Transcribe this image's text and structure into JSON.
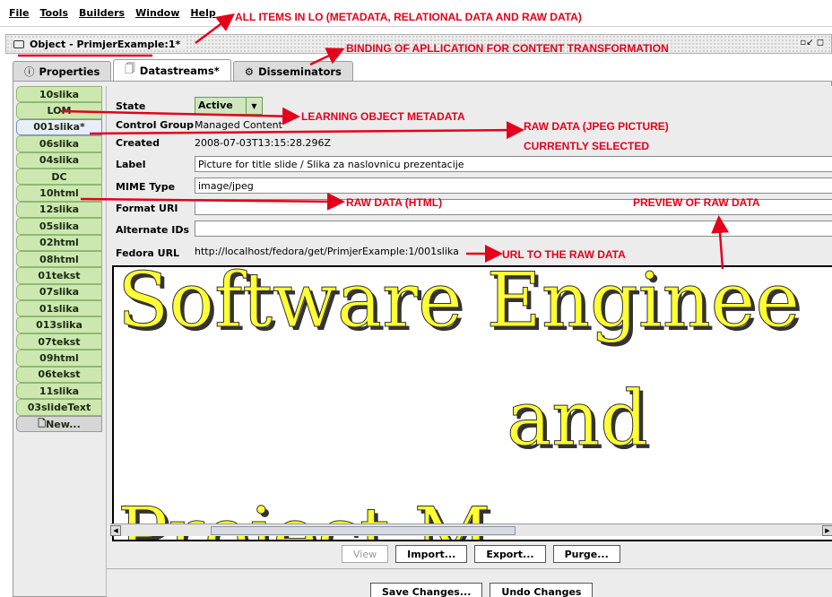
{
  "menubar": {
    "items": [
      "File",
      "Tools",
      "Builders",
      "Window",
      "Help"
    ]
  },
  "window": {
    "title": "Object - PrimjerExample:1*",
    "controls": "▫↙ ◻"
  },
  "tabs": [
    {
      "label": "Properties",
      "icon": "info-icon"
    },
    {
      "label": "Datastreams*",
      "icon": "document-icon"
    },
    {
      "label": "Disseminators",
      "icon": "gear-icon"
    }
  ],
  "datastreams": [
    "10slika",
    "LOM",
    "001slika*",
    "06slika",
    "04slika",
    "DC",
    "10html",
    "12slika",
    "05slika",
    "02html",
    "08html",
    "01tekst",
    "07slika",
    "01slika",
    "013slika",
    "07tekst",
    "09html",
    "06tekst",
    "11slika",
    "03slideText"
  ],
  "datastream_new": "New...",
  "selected_datastream": "001slika*",
  "fields": {
    "state_label": "State",
    "state_value": "Active",
    "control_group_label": "Control Group",
    "control_group_value": "Managed Content",
    "created_label": "Created",
    "created_value": "2008-07-03T13:15:28.296Z",
    "label_label": "Label",
    "label_value": "Picture for title slide / Slika za naslovnicu prezentacije",
    "mime_label": "MIME Type",
    "mime_value": "image/jpeg",
    "format_uri_label": "Format URI",
    "format_uri_value": "",
    "alt_ids_label": "Alternate IDs",
    "alt_ids_value": "",
    "fedora_url_label": "Fedora URL",
    "fedora_url_value": "http://localhost/fedora/get/PrimjerExample:1/001slika"
  },
  "preview": {
    "line1": "Software Enginee",
    "line2": "and",
    "line3": "Project M"
  },
  "buttons": {
    "view": "View",
    "import": "Import...",
    "export": "Export...",
    "purge": "Purge...",
    "save": "Save Changes...",
    "undo": "Undo Changes"
  },
  "annotations": {
    "all_items": "ALL ITEMS IN LO (METADATA, RELATIONAL DATA AND RAW DATA)",
    "binding": "BINDING OF APLLICATION FOR CONTENT TRANSFORMATION",
    "lom": "LEARNING OBJECT METADATA",
    "raw_jpeg": "RAW DATA (JPEG PICTURE)",
    "selected": "CURRENTLY SELECTED",
    "raw_html": "RAW DATA (HTML)",
    "preview": "PREVIEW OF RAW DATA",
    "url": "URL TO THE RAW DATA"
  },
  "colors": {
    "annotation": "#e4001b",
    "datastream_bg": "#cce8b0",
    "preview_text": "#ffff33"
  }
}
